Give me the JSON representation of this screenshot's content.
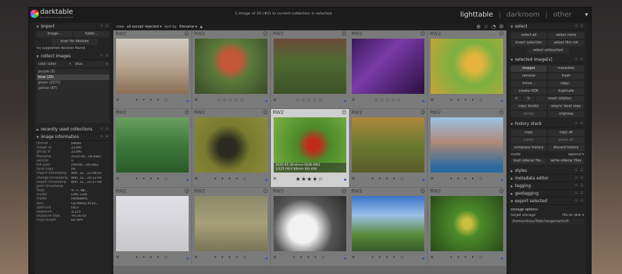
{
  "header": {
    "logo_text": "darktable",
    "logo_sub": "the open source photo workflow",
    "info": "1 image of 20 (#2) in current collection is selected",
    "views": [
      "lighttable",
      "darkroom",
      "other"
    ],
    "active_view": "lighttable"
  },
  "left": {
    "import": {
      "title": "import",
      "buttons": [
        "image...",
        "folder..."
      ],
      "scan_button": "scan for devices",
      "status": "no supported devices found"
    },
    "collect": {
      "title": "collect images",
      "field": "color label",
      "value": "blue",
      "items": [
        "purple (5)",
        "blue (20)",
        "green (2072)",
        "yellow (87)"
      ],
      "selected_index": 1
    },
    "recent_title": "recently used collections",
    "info_title": "image information",
    "info_rows": [
      {
        "k": "filmroll",
        "v": "tieves"
      },
      {
        "k": "image id",
        "v": "22380"
      },
      {
        "k": "group id",
        "v": "22380"
      },
      {
        "k": "filename",
        "v": "2020-05...06.RW2"
      },
      {
        "k": "version",
        "v": "0"
      },
      {
        "k": "full path",
        "v": "/home/...06.RW2"
      },
      {
        "k": "local copy",
        "v": "no"
      },
      {
        "k": "import timestamp",
        "v": "dim. 31...12:09:03"
      },
      {
        "k": "change timestamp",
        "v": "dim. 31...16:52:45"
      },
      {
        "k": "export timestamp",
        "v": "dim. 31...15:37:06"
      },
      {
        "k": "print timestamp",
        "v": ""
      },
      {
        "k": "flags",
        "v": "4...r...ap..."
      },
      {
        "k": "model",
        "v": "DMC-GX8"
      },
      {
        "k": "maker",
        "v": "Panasonic"
      },
      {
        "k": "lens",
        "v": "OLYMPUS M.60..."
      },
      {
        "k": "aperture",
        "v": "f/8.0"
      },
      {
        "k": "exposure",
        "v": "1/125"
      },
      {
        "k": "exposure bias",
        "v": "+0.00 EV"
      },
      {
        "k": "focal length",
        "v": "60 mm"
      }
    ]
  },
  "topbar": {
    "view_label": "view",
    "view_value": "all except rejected",
    "sort_label": "sort by",
    "sort_value": "filename"
  },
  "grid": {
    "ext": "RW2",
    "overlay_line1": "2020-05-30-eleve-0836.RW2",
    "overlay_line2": "1/125 f/8.0 60mm ISO 400"
  },
  "right": {
    "select": {
      "title": "select",
      "buttons": [
        "select all",
        "select none",
        "invert selection",
        "select film roll",
        "select untouched"
      ]
    },
    "selected": {
      "title": "selected image[s]",
      "tabs": [
        "images",
        "metadata"
      ],
      "buttons": [
        "remove",
        "trash",
        "move...",
        "copy...",
        "create HDR",
        "duplicate",
        "reset rotation",
        "copy locally",
        "resync local copy",
        "group",
        "ungroup"
      ]
    },
    "history": {
      "title": "history stack",
      "buttons": [
        "copy",
        "copy all",
        "paste",
        "paste all",
        "compress history",
        "discard history"
      ],
      "mode_label": "mode",
      "mode_value": "append",
      "load_button": "load sidecar file...",
      "write_button": "write sidecar files"
    },
    "collapsed": [
      "styles",
      "metadata editor",
      "tagging",
      "geotagging",
      "export selected"
    ],
    "storage": {
      "title": "storage options",
      "target_label": "target storage",
      "target_value": "file on disk",
      "path": "/home/nilsuu/Téléchargements/fr"
    }
  },
  "colors": {
    "accent_dot": "#3355cc",
    "panel": "#242424",
    "grid_bg": "#6a6a6a"
  }
}
